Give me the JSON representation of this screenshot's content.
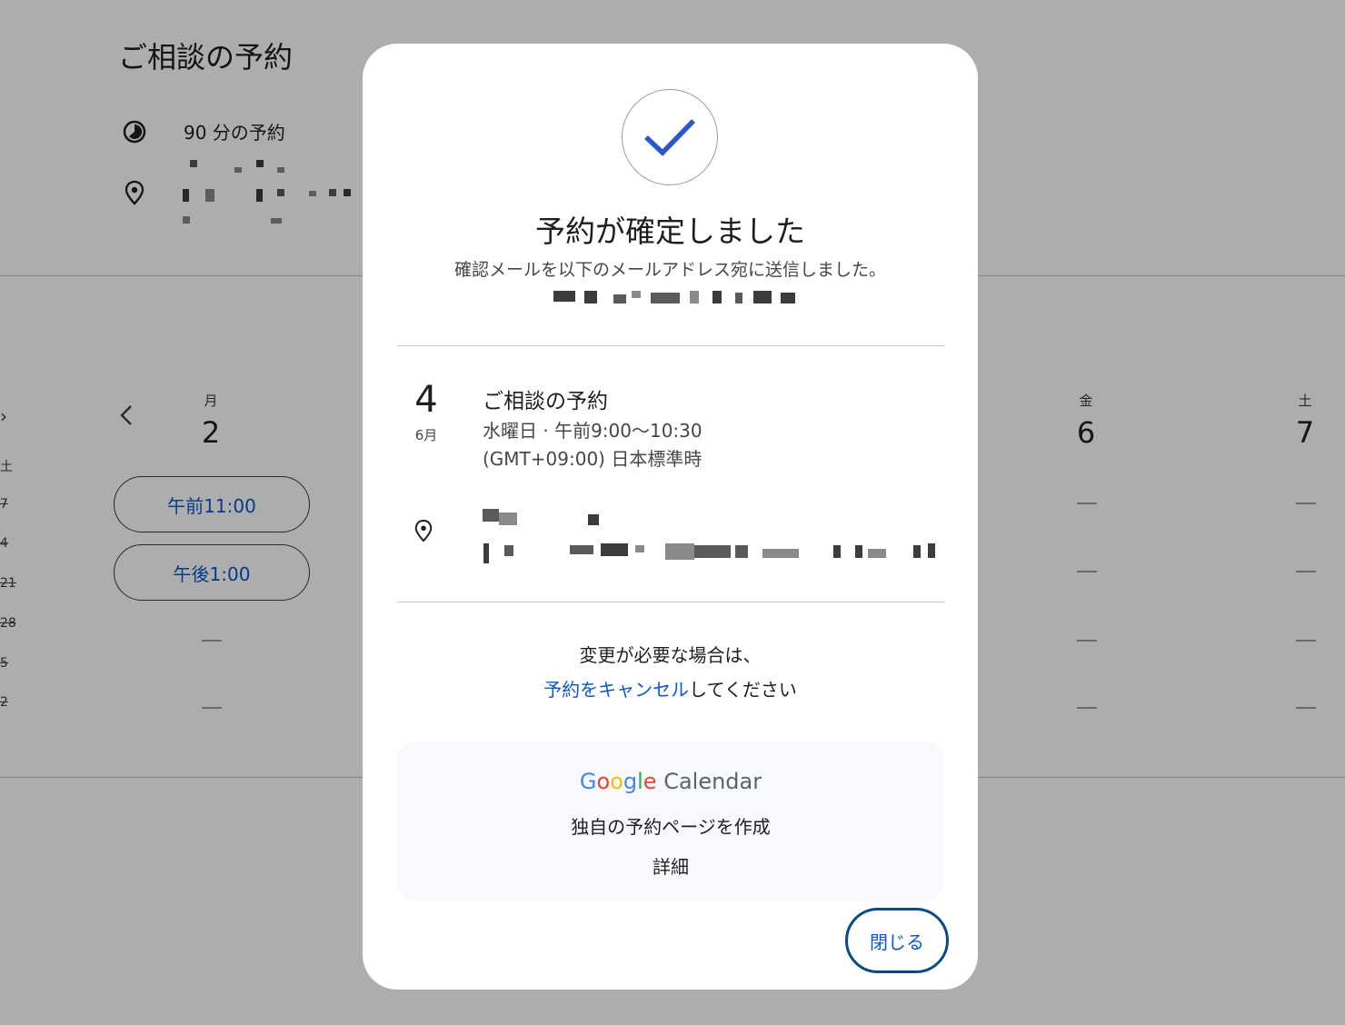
{
  "background": {
    "page_title": "ご相談の予約",
    "duration_text": "90 分の予約",
    "week": [
      {
        "dow": "月",
        "day": "2"
      },
      {
        "dow": "金",
        "day": "6"
      },
      {
        "dow": "土",
        "day": "7"
      }
    ],
    "slots": [
      "午前11:00",
      "午後1:00"
    ],
    "left_edge": [
      "土",
      "7",
      "4",
      "21",
      "28",
      "5",
      "2"
    ]
  },
  "dialog": {
    "title": "予約が確定しました",
    "subtitle": "確認メールを以下のメールアドレス宛に送信しました。",
    "event": {
      "day": "4",
      "month": "6月",
      "title": "ご相談の予約",
      "time": "水曜日 · 午前9:00～10:30",
      "timezone": "(GMT+09:00) 日本標準時"
    },
    "change": {
      "line1": "変更が必要な場合は、",
      "cancel_link": "予約をキャンセル",
      "line2_suffix": "してください"
    },
    "promo": {
      "brand_letters": [
        "G",
        "o",
        "o",
        "g",
        "l",
        "e"
      ],
      "brand_product": "Calendar",
      "make_page": "独自の予約ページを作成",
      "details": "詳細"
    },
    "close_label": "閉じる"
  },
  "colors": {
    "accent": "#0b57d0",
    "google_blue": "#4285f4",
    "google_red": "#ea4335",
    "google_yellow": "#fbbc05",
    "google_green": "#34a853",
    "check": "#2a57c9"
  }
}
